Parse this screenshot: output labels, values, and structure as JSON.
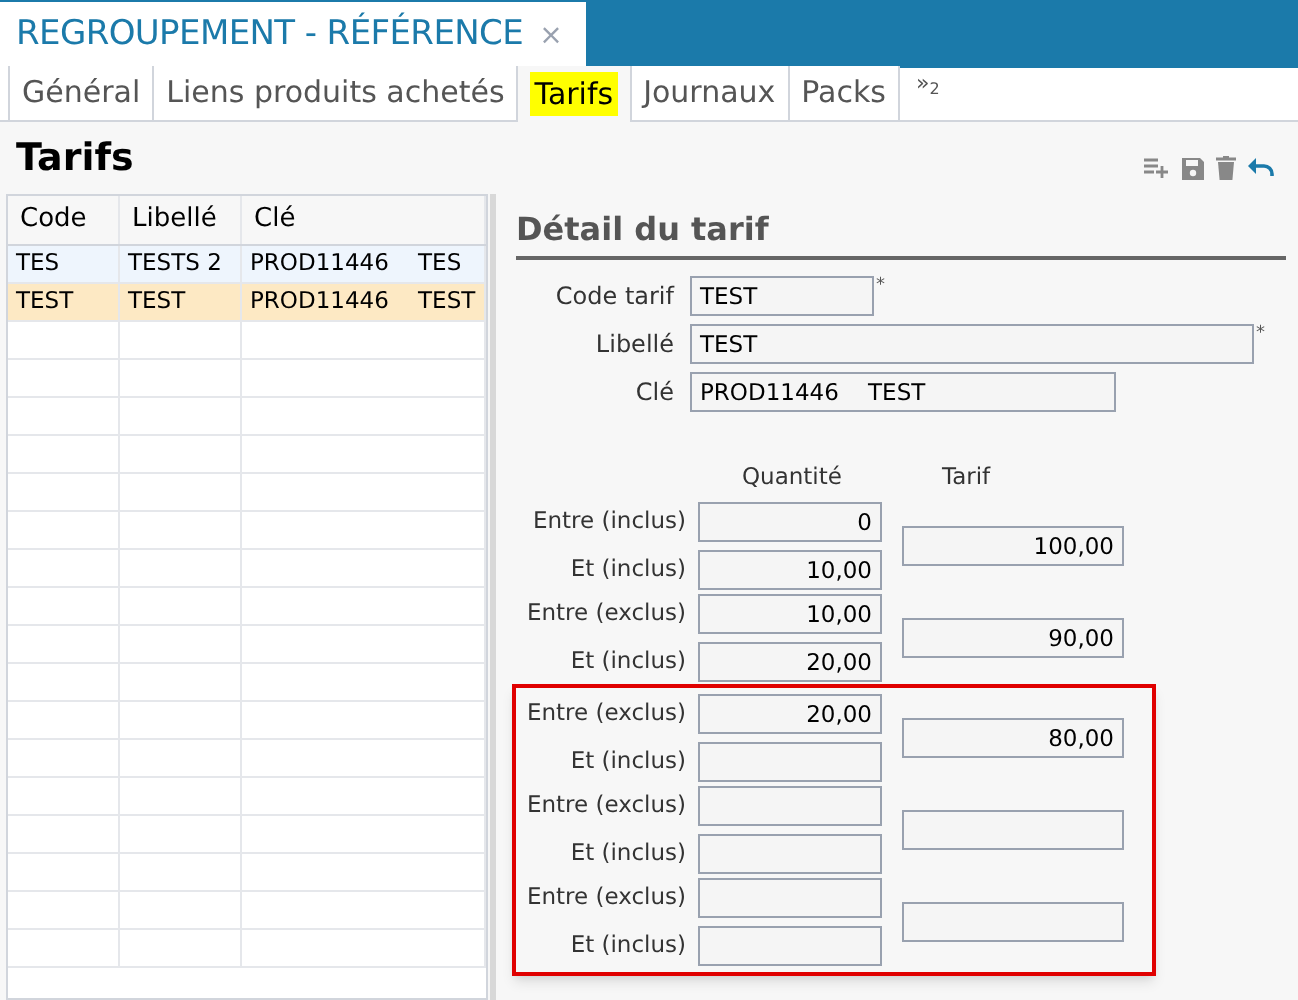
{
  "document_tab": {
    "title": "REGROUPEMENT - RÉFÉRENCE",
    "close": "×"
  },
  "tabs": [
    {
      "label": "Général",
      "selected": false
    },
    {
      "label": "Liens produits achetés",
      "selected": false
    },
    {
      "label": "Tarifs",
      "selected": true
    },
    {
      "label": "Journaux",
      "selected": false
    },
    {
      "label": "Packs",
      "selected": false
    }
  ],
  "more_tabs": {
    "chevron": "»",
    "count": "2"
  },
  "heading": "Tarifs",
  "list": {
    "columns": [
      "Code",
      "Libellé",
      "Clé"
    ],
    "rows": [
      {
        "code": "TES",
        "label": "TESTS 2",
        "key": "PROD11446    TES",
        "selected": false
      },
      {
        "code": "TEST",
        "label": "TEST",
        "key": "PROD11446    TEST",
        "selected": true
      }
    ]
  },
  "detail": {
    "title": "Détail du tarif",
    "fields": [
      {
        "label": "Code tarif",
        "value": "TEST",
        "required_mark": "*"
      },
      {
        "label": "Libellé",
        "value": "TEST",
        "required_mark": "*"
      },
      {
        "label": "Clé",
        "value": "PROD11446    TEST"
      }
    ],
    "quantity_header": "Quantité",
    "price_header": "Tarif",
    "tiers": [
      {
        "from_label": "Entre (inclus)",
        "from": "0",
        "to_label": "Et (inclus)",
        "to": "10,00",
        "price": "100,00"
      },
      {
        "from_label": "Entre (exclus)",
        "from": "10,00",
        "to_label": "Et (inclus)",
        "to": "20,00",
        "price": "90,00"
      }
    ],
    "red_frame": {
      "tiers": [
        {
          "from_label": "Entre (exclus)",
          "from": "20,00",
          "to_label": "Et (inclus)",
          "price": "80,00"
        },
        {
          "from_label": "Entre (exclus)",
          "to_label": "Et (inclus)"
        },
        {
          "from_label": "Entre (exclus)",
          "to_label": "Et (inclus)"
        }
      ]
    }
  }
}
